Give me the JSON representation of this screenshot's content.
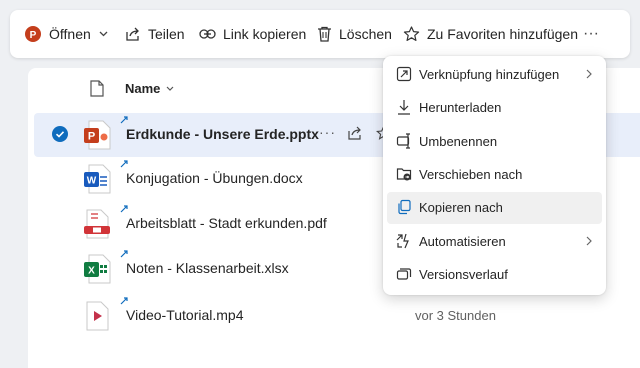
{
  "toolbar": {
    "open_label": "Öffnen",
    "share_label": "Teilen",
    "copy_link_label": "Link kopieren",
    "delete_label": "Löschen",
    "favorite_label": "Zu Favoriten hinzufügen",
    "more_label": "···"
  },
  "list": {
    "name_header": "Name",
    "rows": [
      {
        "name": "Erdkunde - Unsere Erde.pptx",
        "type": "pptx",
        "selected": true,
        "date": ""
      },
      {
        "name": "Konjugation - Übungen.docx",
        "type": "docx",
        "selected": false,
        "date": ""
      },
      {
        "name": "Arbeitsblatt - Stadt erkunden.pdf",
        "type": "pdf",
        "selected": false,
        "date": ""
      },
      {
        "name": "Noten - Klassenarbeit.xlsx",
        "type": "xlsx",
        "selected": false,
        "date": ""
      },
      {
        "name": "Video-Tutorial.mp4",
        "type": "mp4",
        "selected": false,
        "date": "vor 3 Stunden"
      }
    ],
    "row_more": "···"
  },
  "context_menu": {
    "items": [
      {
        "label": "Verknüpfung hinzufügen",
        "icon": "shortcut-icon",
        "submenu": true
      },
      {
        "label": "Herunterladen",
        "icon": "download-icon",
        "submenu": false
      },
      {
        "label": "Umbenennen",
        "icon": "rename-icon",
        "submenu": false
      },
      {
        "label": "Verschieben nach",
        "icon": "move-icon",
        "submenu": false
      },
      {
        "label": "Kopieren nach",
        "icon": "copy-icon",
        "submenu": false,
        "hover": true
      },
      {
        "label": "Automatisieren",
        "icon": "automate-icon",
        "submenu": true
      },
      {
        "label": "Versionsverlauf",
        "icon": "version-history-icon",
        "submenu": false
      }
    ]
  },
  "colors": {
    "accent": "#0f6cbd",
    "powerpoint": "#c43e1c",
    "word": "#185abd",
    "excel": "#107c41",
    "pdf": "#d13438",
    "selected_row": "#e8eefa"
  }
}
